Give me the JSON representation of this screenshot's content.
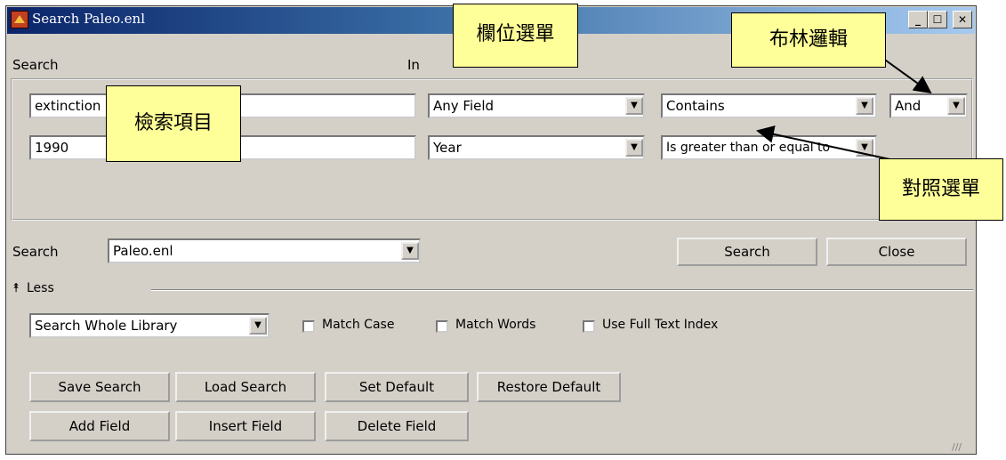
{
  "window": {
    "title": "Search Paleo.enl",
    "column_search_label": "Search",
    "column_in_label": "In"
  },
  "criteria": [
    {
      "term": "extinction",
      "field": "Any Field",
      "comparison": "Contains",
      "boolean": "And"
    },
    {
      "term": "1990",
      "field": "Year",
      "comparison": "Is greater than or equal to"
    }
  ],
  "library": {
    "label": "Search",
    "value": "Paleo.enl"
  },
  "buttons": {
    "search": "Search",
    "close": "Close",
    "save_search": "Save Search",
    "load_search": "Load Search",
    "set_default": "Set Default",
    "restore_default": "Restore Default",
    "add_field": "Add Field",
    "insert_field": "Insert Field",
    "delete_field": "Delete Field"
  },
  "less_toggle": "Less",
  "scope": {
    "value": "Search Whole Library"
  },
  "options": {
    "match_case": "Match Case",
    "match_words": "Match Words",
    "use_full_text_index": "Use Full Text Index"
  },
  "annotations": {
    "field_menu": "欄位選單",
    "boolean_logic": "布林邏輯",
    "search_term": "檢索項目",
    "comparison_menu": "對照選單"
  }
}
